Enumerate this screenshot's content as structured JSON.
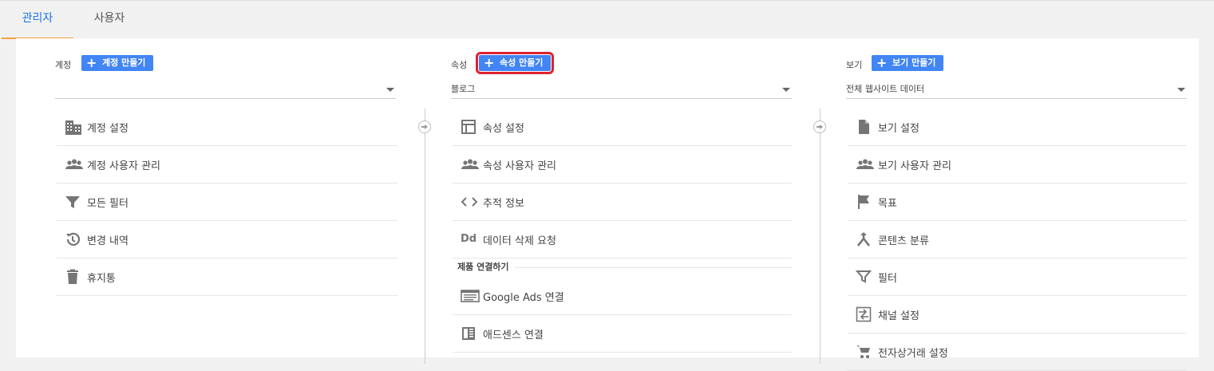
{
  "tabs": [
    {
      "label": "관리자",
      "active": true
    },
    {
      "label": "사용자",
      "active": false
    }
  ],
  "account": {
    "heading": "계정",
    "create_label": "계정 만들기",
    "selected": "",
    "items": [
      {
        "icon": "building-icon",
        "label": "계정 설정"
      },
      {
        "icon": "people-icon",
        "label": "계정 사용자 관리"
      },
      {
        "icon": "filter-icon",
        "label": "모든 필터"
      },
      {
        "icon": "history-icon",
        "label": "변경 내역"
      },
      {
        "icon": "trash-icon",
        "label": "휴지통"
      }
    ]
  },
  "property": {
    "heading": "속성",
    "create_label": "속성 만들기",
    "selected": "블로그",
    "items": [
      {
        "icon": "layout-icon",
        "label": "속성 설정"
      },
      {
        "icon": "people-icon",
        "label": "속성 사용자 관리"
      },
      {
        "icon": "code-icon",
        "label": "추적 정보"
      },
      {
        "icon": "dd-icon",
        "label": "데이터 삭제 요청"
      }
    ],
    "section_label": "제품 연결하기",
    "link_items": [
      {
        "icon": "ads-icon",
        "label": "Google Ads 연결"
      },
      {
        "icon": "adsense-icon",
        "label": "애드센스 연결"
      }
    ]
  },
  "view": {
    "heading": "보기",
    "create_label": "보기 만들기",
    "selected": "전체 웹사이트 데이터",
    "items": [
      {
        "icon": "document-icon",
        "label": "보기 설정"
      },
      {
        "icon": "people-icon",
        "label": "보기 사용자 관리"
      },
      {
        "icon": "flag-icon",
        "label": "목표"
      },
      {
        "icon": "merge-icon",
        "label": "콘텐츠 분류"
      },
      {
        "icon": "filter-icon",
        "label": "필터"
      },
      {
        "icon": "channel-icon",
        "label": "채널 설정"
      },
      {
        "icon": "cart-icon",
        "label": "전자상거래 설정"
      }
    ]
  },
  "colors": {
    "accent": "#4285f4",
    "tab_active_text": "#1a73e8",
    "tab_underline": "#f4a23c",
    "highlight": "#e0212e",
    "icon": "#757575"
  }
}
